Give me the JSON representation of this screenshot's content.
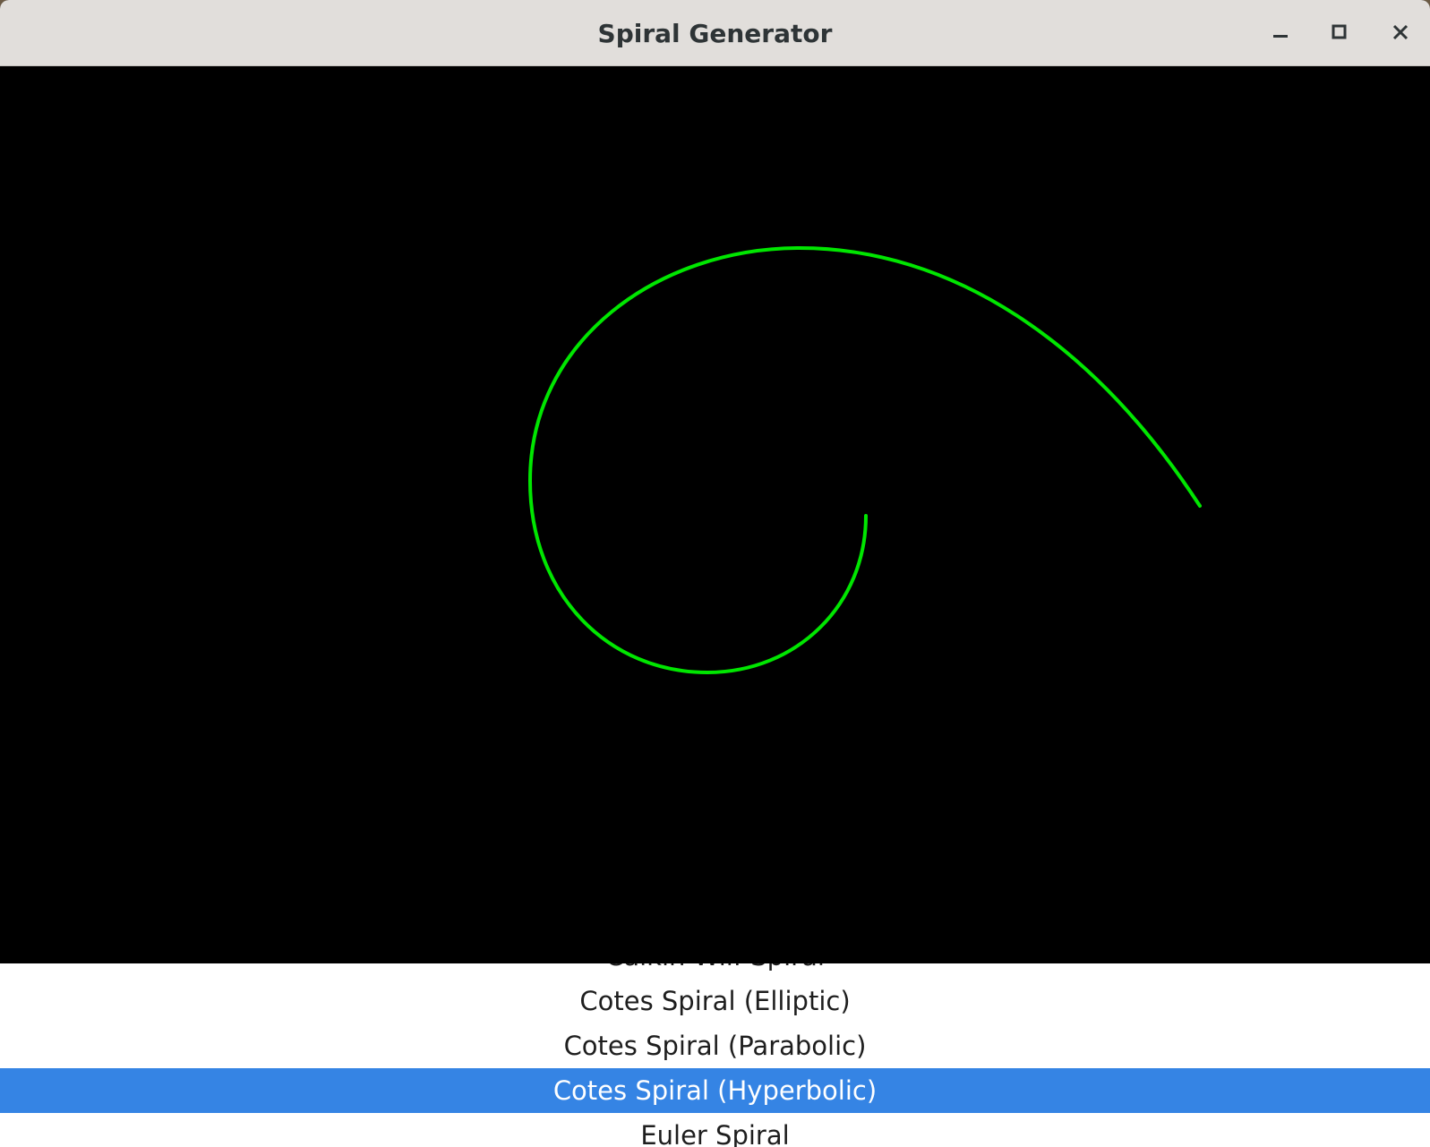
{
  "window": {
    "title": "Spiral Generator"
  },
  "titlebar_buttons": {
    "minimize_icon": "minimize-icon",
    "maximize_icon": "maximize-icon",
    "close_icon": "close-icon"
  },
  "canvas": {
    "background": "#000000",
    "curve_color": "#00e600",
    "curve_name": "Cotes Spiral (Hyperbolic)"
  },
  "spiral_list": {
    "items": [
      {
        "label": "Calkin-Wilf Spiral",
        "selected": false
      },
      {
        "label": "Cotes Spiral (Elliptic)",
        "selected": false
      },
      {
        "label": "Cotes Spiral (Parabolic)",
        "selected": false
      },
      {
        "label": "Cotes Spiral (Hyperbolic)",
        "selected": true
      },
      {
        "label": "Euler Spiral",
        "selected": false
      }
    ],
    "selected_color": "#3584e4"
  }
}
